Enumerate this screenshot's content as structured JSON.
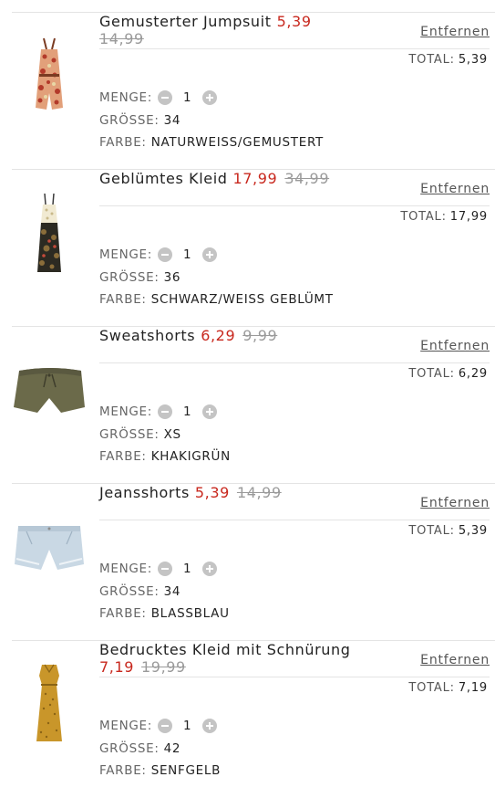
{
  "labels": {
    "remove": "Entfernen",
    "total": "TOTAL:",
    "quantity": "MENGE:",
    "size": "GRÖSSE:",
    "color": "FARBE:"
  },
  "items": [
    {
      "name": "Gemusterter Jumpsuit",
      "sale_price": "5,39",
      "original_price": "14,99",
      "total": "5,39",
      "quantity": "1",
      "size": "34",
      "color": "NATURWEISS/GEMUSTERT",
      "thumbnail": "patterned-jumpsuit"
    },
    {
      "name": "Geblümtes Kleid",
      "sale_price": "17,99",
      "original_price": "34,99",
      "total": "17,99",
      "quantity": "1",
      "size": "36",
      "color": "SCHWARZ/WEISS GEBLÜMT",
      "thumbnail": "floral-dress"
    },
    {
      "name": "Sweatshorts",
      "sale_price": "6,29",
      "original_price": "9,99",
      "total": "6,29",
      "quantity": "1",
      "size": "XS",
      "color": "KHAKIGRÜN",
      "thumbnail": "khaki-sweatshorts"
    },
    {
      "name": "Jeansshorts",
      "sale_price": "5,39",
      "original_price": "14,99",
      "total": "5,39",
      "quantity": "1",
      "size": "34",
      "color": "BLASSBLAU",
      "thumbnail": "denim-shorts"
    },
    {
      "name": "Bedrucktes Kleid mit Schnürung",
      "sale_price": "7,19",
      "original_price": "19,99",
      "total": "7,19",
      "quantity": "1",
      "size": "42",
      "color": "SENFGELB",
      "thumbnail": "mustard-printed-dress"
    }
  ],
  "colors": {
    "sale": "#c8281e",
    "strikethrough": "#9a9a9a",
    "divider": "#e4e4e4",
    "qty_button": "#c4c4c4"
  }
}
